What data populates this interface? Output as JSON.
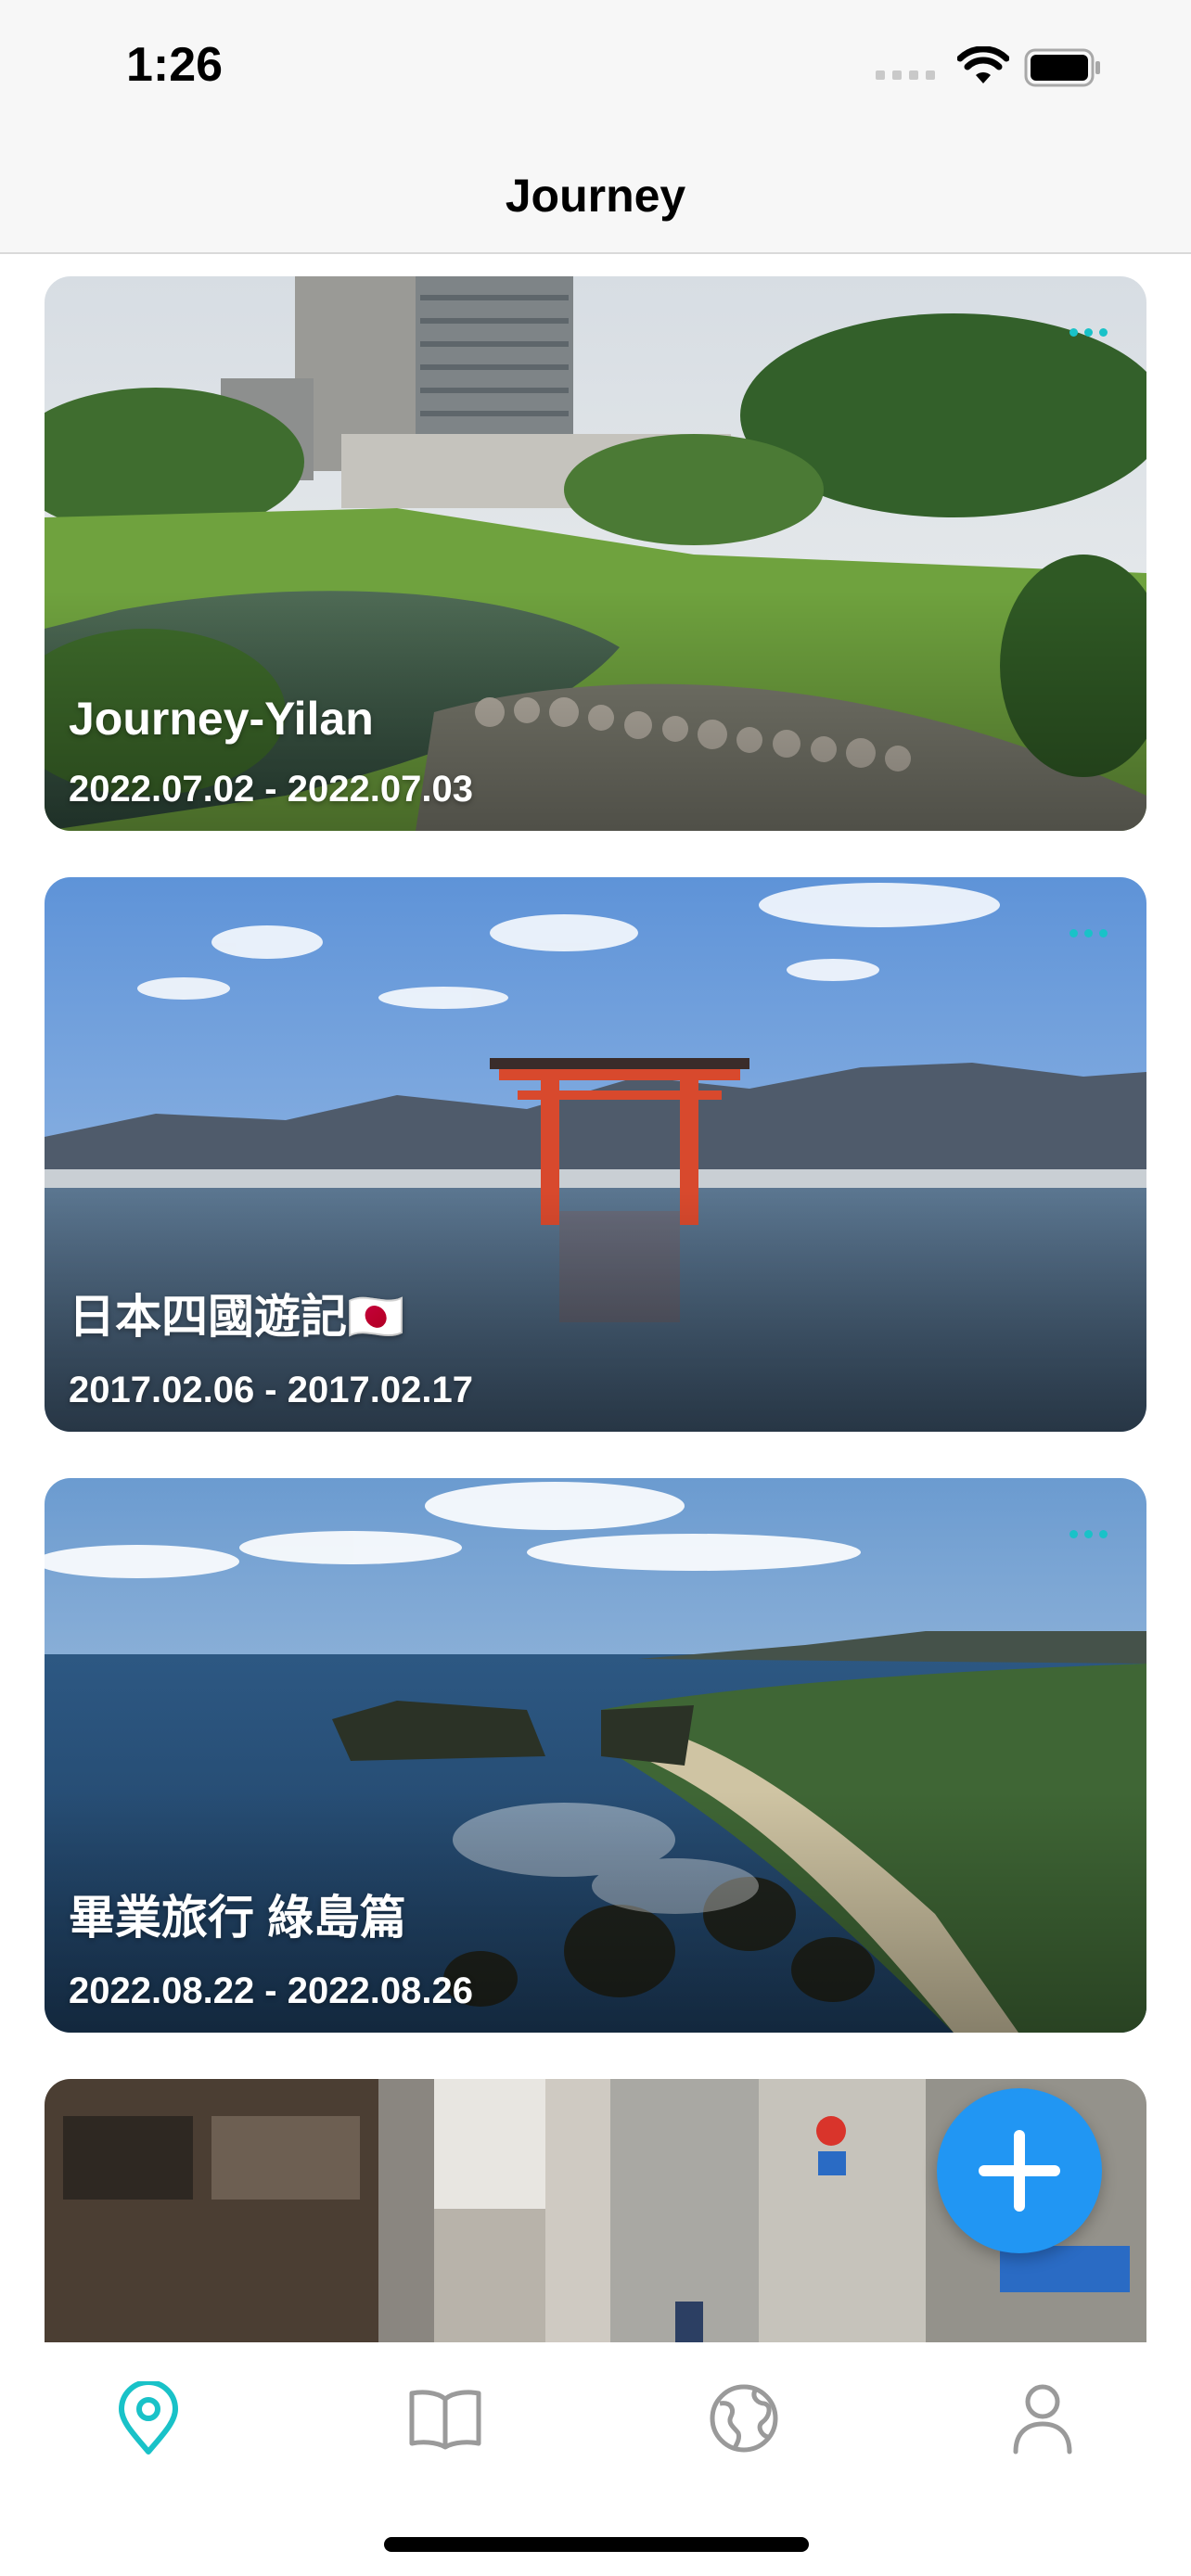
{
  "status_bar": {
    "time": "1:26"
  },
  "nav": {
    "title": "Journey"
  },
  "journeys": [
    {
      "title": "Journey-Yilan",
      "dates": "2022.07.02 - 2022.07.03",
      "photo": "resort-garden-pond"
    },
    {
      "title": "日本四國遊記🇯🇵",
      "dates": "2017.02.06 - 2017.02.17",
      "photo": "floating-torii-gate-sea"
    },
    {
      "title": "畢業旅行 綠島篇",
      "dates": "2022.08.22 - 2022.08.26",
      "photo": "green-island-coastline"
    },
    {
      "title": "",
      "dates": "",
      "photo": "old-town-street"
    }
  ],
  "tab_bar": {
    "items": [
      {
        "name": "journey",
        "icon": "map-pin-icon",
        "active": true
      },
      {
        "name": "diary",
        "icon": "open-book-icon",
        "active": false
      },
      {
        "name": "explore",
        "icon": "globe-icon",
        "active": false
      },
      {
        "name": "profile",
        "icon": "person-icon",
        "active": false
      }
    ]
  },
  "colors": {
    "accent": "#19c2c8",
    "fab": "#2196f3",
    "tab_inactive": "#9a9a9a"
  }
}
